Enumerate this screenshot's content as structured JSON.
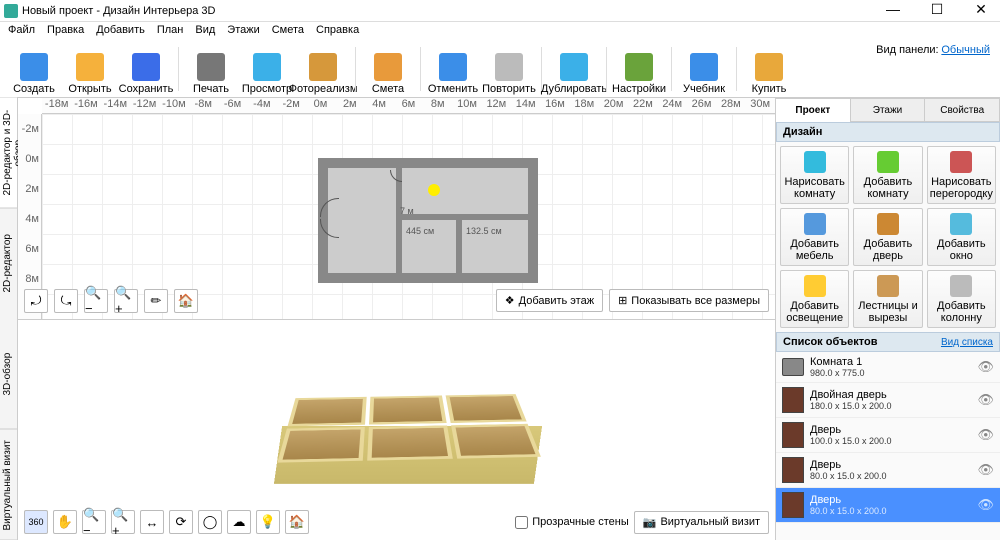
{
  "window": {
    "title": "Новый проект - Дизайн Интерьера 3D"
  },
  "menu": [
    "Файл",
    "Правка",
    "Добавить",
    "План",
    "Вид",
    "Этажи",
    "Смета",
    "Справка"
  ],
  "toolbar": [
    {
      "label": "Создать",
      "icon": "#3b8ee8"
    },
    {
      "label": "Открыть",
      "icon": "#f5b13c"
    },
    {
      "label": "Сохранить",
      "icon": "#3b6de8"
    },
    {
      "sep": true
    },
    {
      "label": "Печать",
      "icon": "#777"
    },
    {
      "label": "Просмотр",
      "icon": "#3bb0e8"
    },
    {
      "label": "Фотореализм",
      "icon": "#d6983b"
    },
    {
      "sep": true
    },
    {
      "label": "Смета",
      "icon": "#e89a3b"
    },
    {
      "sep": true
    },
    {
      "label": "Отменить",
      "icon": "#3b8ee8"
    },
    {
      "label": "Повторить",
      "icon": "#bbb"
    },
    {
      "sep": true
    },
    {
      "label": "Дублировать",
      "icon": "#3bb0e8"
    },
    {
      "sep": true
    },
    {
      "label": "Настройки",
      "icon": "#6aa33b"
    },
    {
      "sep": true
    },
    {
      "label": "Учебник",
      "icon": "#3b8ee8"
    },
    {
      "sep": true
    },
    {
      "label": "Купить",
      "icon": "#e8a83b"
    }
  ],
  "view_panel": {
    "label": "Вид панели:",
    "value": "Обычный"
  },
  "vtabs": [
    "2D-редактор и 3D-обзор",
    "2D-редактор",
    "3D-обзор",
    "Виртуальный визит"
  ],
  "ruler_h": [
    "-18м",
    "-16м",
    "-14м",
    "-12м",
    "-10м",
    "-8м",
    "-6м",
    "-4м",
    "-2м",
    "0м",
    "2м",
    "4м",
    "6м",
    "8м",
    "10м",
    "12м",
    "14м",
    "16м",
    "18м",
    "20м",
    "22м",
    "24м",
    "26м",
    "28м",
    "30м"
  ],
  "ruler_v": [
    "-2м",
    "0м",
    "2м",
    "4м",
    "6м",
    "8м"
  ],
  "dims": {
    "w1": "445 см",
    "w2": "132.5 см",
    "small": "7    м"
  },
  "planbar": {
    "add_floor": "Добавить этаж",
    "show_dims": "Показывать все размеры"
  },
  "plan_tool_icons": [
    "⤾",
    "⤿",
    "🔍−",
    "🔍+",
    "✏",
    "🏠"
  ],
  "bottombar": {
    "icons": [
      "360",
      "✋",
      "🔍−",
      "🔍+",
      "↔",
      "⟳",
      "◯",
      "☁",
      "💡",
      "🏠"
    ],
    "transparent": "Прозрачные стены",
    "visit": "Виртуальный визит"
  },
  "tabs": [
    "Проект",
    "Этажи",
    "Свойства"
  ],
  "design": {
    "title": "Дизайн",
    "buttons": [
      {
        "l1": "Нарисовать",
        "l2": "комнату"
      },
      {
        "l1": "Добавить",
        "l2": "комнату"
      },
      {
        "l1": "Нарисовать",
        "l2": "перегородку"
      },
      {
        "l1": "Добавить",
        "l2": "мебель"
      },
      {
        "l1": "Добавить",
        "l2": "дверь"
      },
      {
        "l1": "Добавить",
        "l2": "окно"
      },
      {
        "l1": "Добавить",
        "l2": "освещение"
      },
      {
        "l1": "Лестницы и",
        "l2": "вырезы"
      },
      {
        "l1": "Добавить",
        "l2": "колонну"
      }
    ]
  },
  "objects": {
    "title": "Список объектов",
    "viewlink": "Вид списка",
    "items": [
      {
        "name": "Комната 1",
        "dim": "980.0 x 775.0",
        "type": "room"
      },
      {
        "name": "Двойная дверь",
        "dim": "180.0 x 15.0 x 200.0",
        "type": "door"
      },
      {
        "name": "Дверь",
        "dim": "100.0 x 15.0 x 200.0",
        "type": "door"
      },
      {
        "name": "Дверь",
        "dim": "80.0 x 15.0 x 200.0",
        "type": "door"
      },
      {
        "name": "Дверь",
        "dim": "80.0 x 15.0 x 200.0",
        "type": "door",
        "sel": true
      }
    ]
  }
}
